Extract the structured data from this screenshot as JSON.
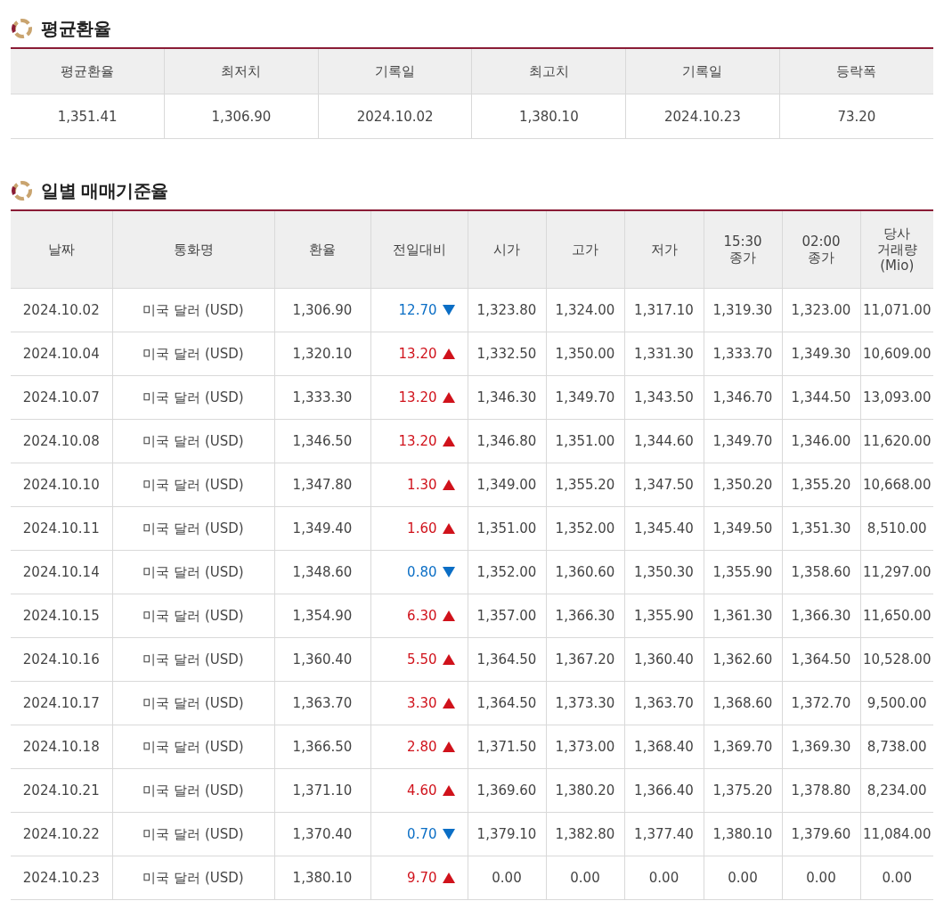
{
  "average_section": {
    "title": "평균환율",
    "columns": [
      "평균환율",
      "최저치",
      "기록일",
      "최고치",
      "기록일",
      "등락폭"
    ],
    "row": [
      "1,351.41",
      "1,306.90",
      "2024.10.02",
      "1,380.10",
      "2024.10.23",
      "73.20"
    ]
  },
  "daily_section": {
    "title": "일별 매매기준율",
    "columns": [
      "날짜",
      "통화명",
      "환율",
      "전일대비",
      "시가",
      "고가",
      "저가",
      "15:30\n종가",
      "02:00\n종가",
      "당사\n거래량\n(Mio)"
    ],
    "rows": [
      {
        "date": "2024.10.02",
        "currency": "미국 달러 (USD)",
        "rate": "1,306.90",
        "change": "12.70",
        "kind": "down",
        "open": "1,323.80",
        "high": "1,324.00",
        "low": "1,317.10",
        "close_1530": "1,319.30",
        "close_0200": "1,323.00",
        "volume": "11,071.00"
      },
      {
        "date": "2024.10.04",
        "currency": "미국 달러 (USD)",
        "rate": "1,320.10",
        "change": "13.20",
        "kind": "up",
        "open": "1,332.50",
        "high": "1,350.00",
        "low": "1,331.30",
        "close_1530": "1,333.70",
        "close_0200": "1,349.30",
        "volume": "10,609.00"
      },
      {
        "date": "2024.10.07",
        "currency": "미국 달러 (USD)",
        "rate": "1,333.30",
        "change": "13.20",
        "kind": "up",
        "open": "1,346.30",
        "high": "1,349.70",
        "low": "1,343.50",
        "close_1530": "1,346.70",
        "close_0200": "1,344.50",
        "volume": "13,093.00"
      },
      {
        "date": "2024.10.08",
        "currency": "미국 달러 (USD)",
        "rate": "1,346.50",
        "change": "13.20",
        "kind": "up",
        "open": "1,346.80",
        "high": "1,351.00",
        "low": "1,344.60",
        "close_1530": "1,349.70",
        "close_0200": "1,346.00",
        "volume": "11,620.00"
      },
      {
        "date": "2024.10.10",
        "currency": "미국 달러 (USD)",
        "rate": "1,347.80",
        "change": "1.30",
        "kind": "up",
        "open": "1,349.00",
        "high": "1,355.20",
        "low": "1,347.50",
        "close_1530": "1,350.20",
        "close_0200": "1,355.20",
        "volume": "10,668.00"
      },
      {
        "date": "2024.10.11",
        "currency": "미국 달러 (USD)",
        "rate": "1,349.40",
        "change": "1.60",
        "kind": "up",
        "open": "1,351.00",
        "high": "1,352.00",
        "low": "1,345.40",
        "close_1530": "1,349.50",
        "close_0200": "1,351.30",
        "volume": "8,510.00"
      },
      {
        "date": "2024.10.14",
        "currency": "미국 달러 (USD)",
        "rate": "1,348.60",
        "change": "0.80",
        "kind": "down",
        "open": "1,352.00",
        "high": "1,360.60",
        "low": "1,350.30",
        "close_1530": "1,355.90",
        "close_0200": "1,358.60",
        "volume": "11,297.00"
      },
      {
        "date": "2024.10.15",
        "currency": "미국 달러 (USD)",
        "rate": "1,354.90",
        "change": "6.30",
        "kind": "up",
        "open": "1,357.00",
        "high": "1,366.30",
        "low": "1,355.90",
        "close_1530": "1,361.30",
        "close_0200": "1,366.30",
        "volume": "11,650.00"
      },
      {
        "date": "2024.10.16",
        "currency": "미국 달러 (USD)",
        "rate": "1,360.40",
        "change": "5.50",
        "kind": "up",
        "open": "1,364.50",
        "high": "1,367.20",
        "low": "1,360.40",
        "close_1530": "1,362.60",
        "close_0200": "1,364.50",
        "volume": "10,528.00"
      },
      {
        "date": "2024.10.17",
        "currency": "미국 달러 (USD)",
        "rate": "1,363.70",
        "change": "3.30",
        "kind": "up",
        "open": "1,364.50",
        "high": "1,373.30",
        "low": "1,363.70",
        "close_1530": "1,368.60",
        "close_0200": "1,372.70",
        "volume": "9,500.00"
      },
      {
        "date": "2024.10.18",
        "currency": "미국 달러 (USD)",
        "rate": "1,366.50",
        "change": "2.80",
        "kind": "up",
        "open": "1,371.50",
        "high": "1,373.00",
        "low": "1,368.40",
        "close_1530": "1,369.70",
        "close_0200": "1,369.30",
        "volume": "8,738.00"
      },
      {
        "date": "2024.10.21",
        "currency": "미국 달러 (USD)",
        "rate": "1,371.10",
        "change": "4.60",
        "kind": "up",
        "open": "1,369.60",
        "high": "1,380.20",
        "low": "1,366.40",
        "close_1530": "1,375.20",
        "close_0200": "1,378.80",
        "volume": "8,234.00"
      },
      {
        "date": "2024.10.22",
        "currency": "미국 달러 (USD)",
        "rate": "1,370.40",
        "change": "0.70",
        "kind": "down",
        "open": "1,379.10",
        "high": "1,382.80",
        "low": "1,377.40",
        "close_1530": "1,380.10",
        "close_0200": "1,379.60",
        "volume": "11,084.00"
      },
      {
        "date": "2024.10.23",
        "currency": "미국 달러 (USD)",
        "rate": "1,380.10",
        "change": "9.70",
        "kind": "up",
        "open": "0.00",
        "high": "0.00",
        "low": "0.00",
        "close_1530": "0.00",
        "close_0200": "0.00",
        "volume": "0.00"
      }
    ]
  }
}
